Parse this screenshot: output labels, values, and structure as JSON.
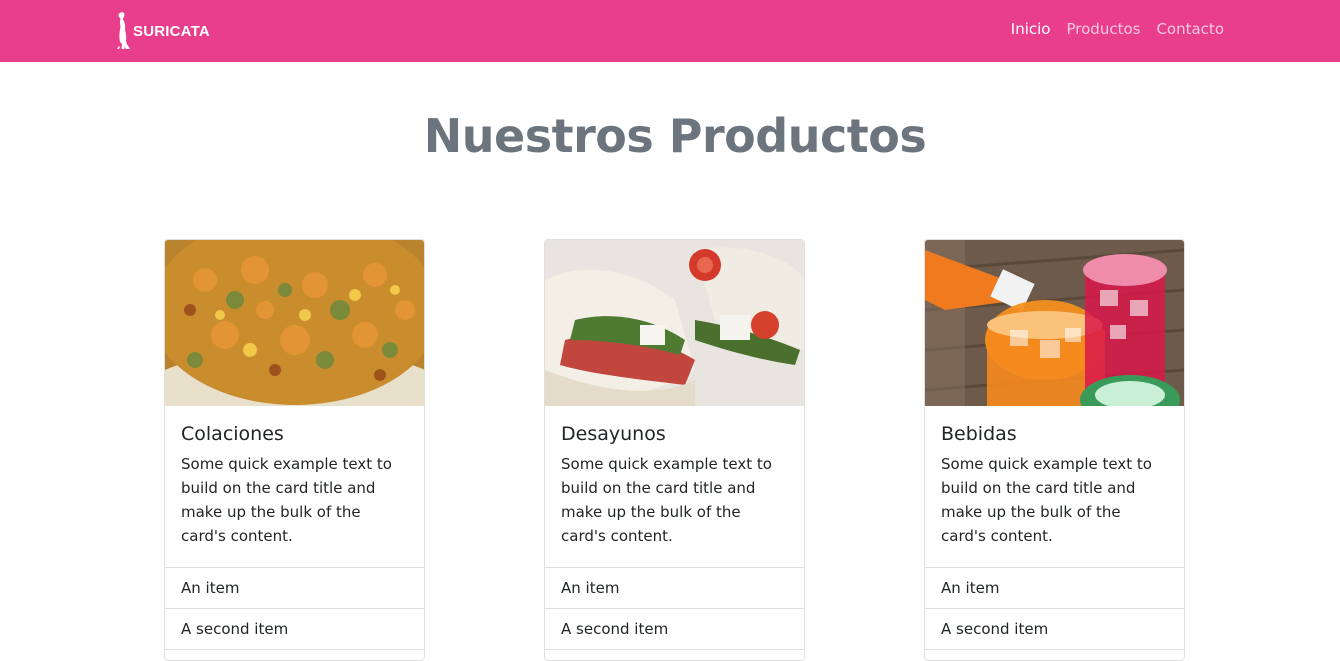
{
  "navbar": {
    "brand": "SURICATA",
    "links": [
      {
        "label": "Inicio",
        "active": true
      },
      {
        "label": "Productos",
        "active": false
      },
      {
        "label": "Contacto",
        "active": false
      }
    ],
    "background": "#e83e8c"
  },
  "main": {
    "title": "Nuestros Productos",
    "cards": [
      {
        "title": "Colaciones",
        "text": "Some quick example text to build on the card title and make up the bulk of the card's content.",
        "items": [
          "An item",
          "A second item"
        ],
        "image": "lentil-stew-photo"
      },
      {
        "title": "Desayunos",
        "text": "Some quick example text to build on the card title and make up the bulk of the card's content.",
        "items": [
          "An item",
          "A second item"
        ],
        "image": "sandwich-photo"
      },
      {
        "title": "Bebidas",
        "text": "Some quick example text to build on the card title and make up the bulk of the card's content.",
        "items": [
          "An item",
          "A second item"
        ],
        "image": "drinks-photo"
      }
    ]
  }
}
